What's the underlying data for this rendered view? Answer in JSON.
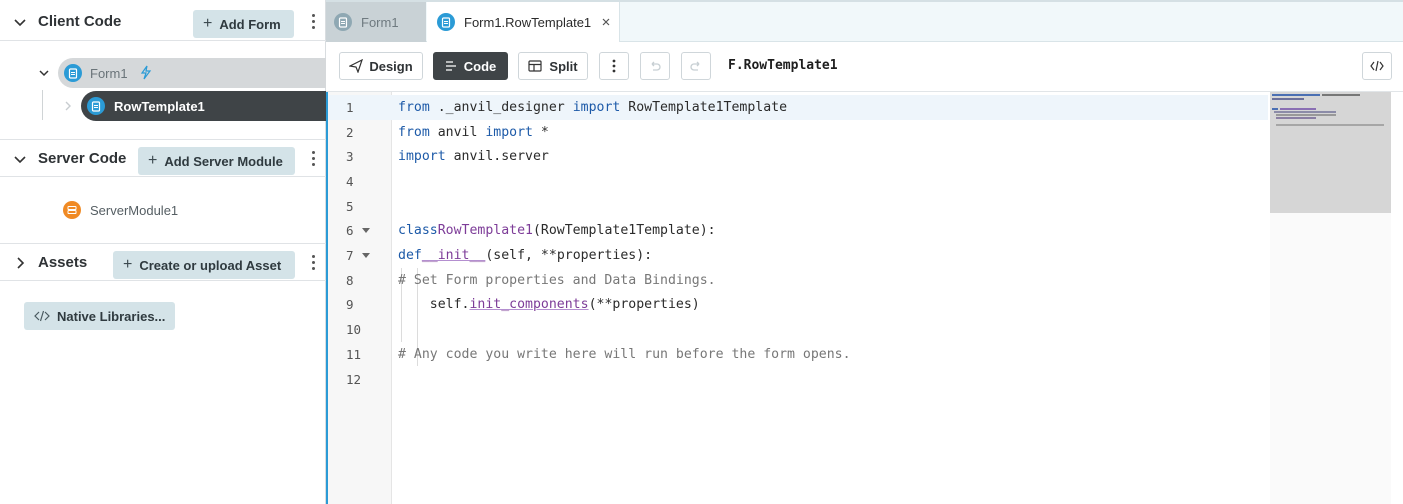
{
  "sidebar": {
    "client_code": {
      "title": "Client Code",
      "add_button": "Add Form"
    },
    "tree": {
      "form1": "Form1",
      "row_template": "RowTemplate1"
    },
    "server_code": {
      "title": "Server Code",
      "add_button": "Add Server Module",
      "module": "ServerModule1"
    },
    "assets": {
      "title": "Assets",
      "add_button": "Create or upload Asset"
    },
    "native_libraries": "Native Libraries..."
  },
  "tabs": [
    {
      "label": "Form1",
      "active": false
    },
    {
      "label": "Form1.RowTemplate1",
      "active": true
    }
  ],
  "toolbar": {
    "design_label": "Design",
    "code_label": "Code",
    "split_label": "Split",
    "active_mode": "Code",
    "file_label": "F.RowTemplate1"
  },
  "editor": {
    "line_numbers": [
      "1",
      "2",
      "3",
      "4",
      "5",
      "6",
      "7",
      "8",
      "9",
      "10",
      "11",
      "12"
    ],
    "lines": [
      "from ._anvil_designer import RowTemplate1Template",
      "from anvil import *",
      "import anvil.server",
      "",
      "",
      "class RowTemplate1(RowTemplate1Template):",
      "  def __init__(self, **properties):",
      "    # Set Form properties and Data Bindings.",
      "    self.init_components(**properties)",
      "",
      "    # Any code you write here will run before the form opens.",
      ""
    ],
    "current_line": 1
  },
  "colors": {
    "accent": "#2b9bd6",
    "button_bg": "#d4e3e8",
    "keyword": "#1d5aa8",
    "class_name": "#7d3c98",
    "server_module": "#f08a24"
  },
  "icons": {
    "chevron_down": "chevron-down-icon",
    "chevron_right": "chevron-right-icon",
    "form": "form-file-icon",
    "server": "server-module-icon",
    "lightning": "lightning-icon",
    "close": "close-icon",
    "code_brackets": "code-brackets-icon"
  }
}
